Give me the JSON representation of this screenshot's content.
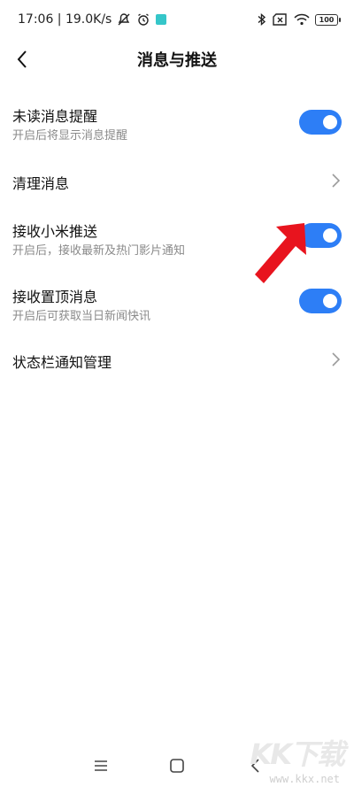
{
  "status_bar": {
    "time_speed": "17:06 | 19.0K/s",
    "battery": "100"
  },
  "header": {
    "title": "消息与推送"
  },
  "settings": [
    {
      "title": "未读消息提醒",
      "subtitle": "开启后将显示消息提醒",
      "control": "toggle",
      "enabled": true
    },
    {
      "title": "清理消息",
      "subtitle": "",
      "control": "chevron"
    },
    {
      "title": "接收小米推送",
      "subtitle": "开启后，接收最新及热门影片通知",
      "control": "toggle",
      "enabled": true
    },
    {
      "title": "接收置顶消息",
      "subtitle": "开启后可获取当日新闻快讯",
      "control": "toggle",
      "enabled": true
    },
    {
      "title": "状态栏通知管理",
      "subtitle": "",
      "control": "chevron"
    }
  ],
  "colors": {
    "toggle_on": "#2d7ef6",
    "annotation_arrow": "#e8141e"
  },
  "watermark": {
    "logo": "KK下载",
    "url": "www.kkx.net"
  }
}
